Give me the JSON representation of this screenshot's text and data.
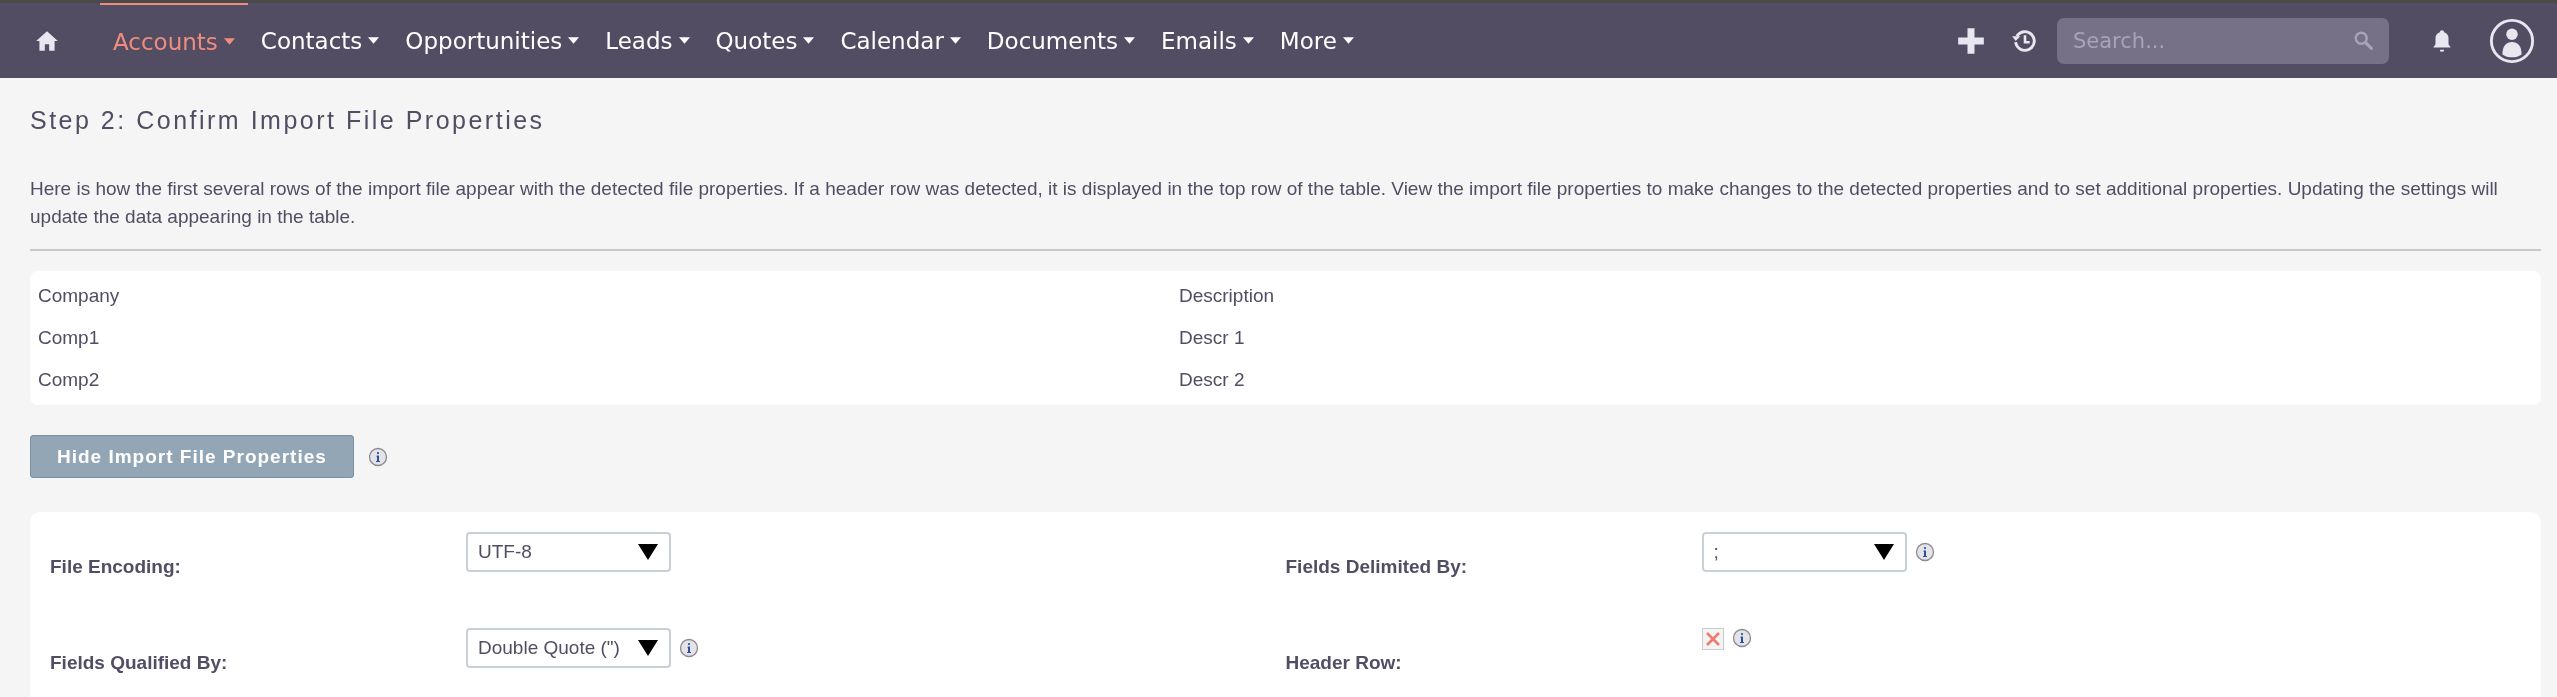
{
  "nav": {
    "items": [
      {
        "label": "Accounts",
        "selected": true
      },
      {
        "label": "Contacts",
        "selected": false
      },
      {
        "label": "Opportunities",
        "selected": false
      },
      {
        "label": "Leads",
        "selected": false
      },
      {
        "label": "Quotes",
        "selected": false
      },
      {
        "label": "Calendar",
        "selected": false
      },
      {
        "label": "Documents",
        "selected": false
      },
      {
        "label": "Emails",
        "selected": false
      },
      {
        "label": "More",
        "selected": false
      }
    ],
    "search": {
      "placeholder": "Search..."
    }
  },
  "page_title": "Step 2: Confirm Import File Properties",
  "intro": "Here is how the first several rows of the import file appear with the detected file properties. If a header row was detected, it is displayed in the top row of the table. View the import file properties to make changes to the detected properties and to set additional properties. Updating the settings will update the data appearing in the table.",
  "preview_rows": [
    [
      "Company",
      "Description"
    ],
    [
      "Comp1",
      "Descr 1"
    ],
    [
      "Comp2",
      "Descr 2"
    ]
  ],
  "toggle_button": "Hide Import File Properties",
  "properties": [
    {
      "label": "File Encoding:",
      "kind": "select",
      "value": "UTF-8",
      "info": false
    },
    {
      "label": "Fields Delimited By:",
      "kind": "select",
      "value": ";",
      "info": true
    },
    {
      "label": "Fields Qualified By:",
      "kind": "select",
      "value": "Double Quote (\")",
      "info": true
    },
    {
      "label": "Header Row:",
      "kind": "cross",
      "info": true
    }
  ]
}
